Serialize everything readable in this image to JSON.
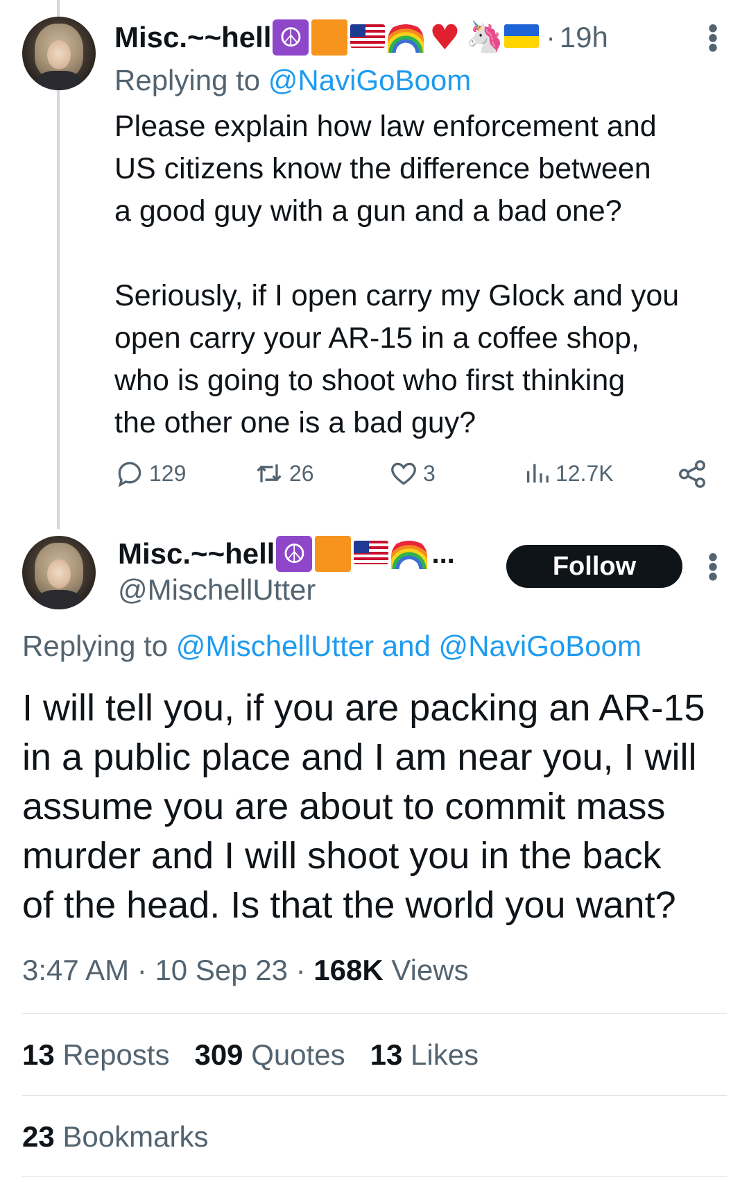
{
  "tweet1": {
    "display_name": "Misc.~~hell",
    "name_emojis": [
      "peace-symbol",
      "orange-square",
      "us-flag",
      "rainbow",
      "red-heart",
      "unicorn",
      "ukraine-flag"
    ],
    "time": "19h",
    "replying_prefix": "Replying to",
    "replying_to": "@NaviGoBoom",
    "body_lines_p1": [
      "Please explain how law enforcement and",
      "US citizens know the difference between",
      "a good guy with a gun and a bad one?"
    ],
    "body_lines_p2": [
      "Seriously, if I open carry my Glock and you",
      "open carry your AR-15 in a coffee shop,",
      "who is going to shoot who first thinking",
      "the other one is a bad guy?"
    ],
    "replies": "129",
    "reposts": "26",
    "likes": "3",
    "views": "12.7K"
  },
  "tweet2": {
    "display_name": "Misc.~~hell",
    "name_emojis": [
      "peace-symbol",
      "orange-square",
      "us-flag",
      "rainbow"
    ],
    "truncation": "...",
    "handle": "@MischellUtter",
    "follow_label": "Follow",
    "replying_prefix": "Replying to",
    "replying_to": "@MischellUtter and @NaviGoBoom",
    "body_lines": [
      "I will tell you, if you are packing an AR-15",
      "in a public place and I am near you, I will",
      "assume you are about to commit mass",
      "murder and I will shoot you in the back",
      "of the head. Is that the world you want?"
    ],
    "time": "3:47 AM",
    "date": "10 Sep 23",
    "views_count": "168K",
    "views_label": "Views",
    "reposts_count": "13",
    "reposts_label": "Reposts",
    "quotes_count": "309",
    "quotes_label": "Quotes",
    "likes_count": "13",
    "likes_label": "Likes",
    "bookmarks_count": "23",
    "bookmarks_label": "Bookmarks"
  },
  "colors": {
    "text": "#0f1419",
    "secondary": "#536471",
    "link": "#1d9bf0",
    "divider": "#dfe4e8"
  }
}
